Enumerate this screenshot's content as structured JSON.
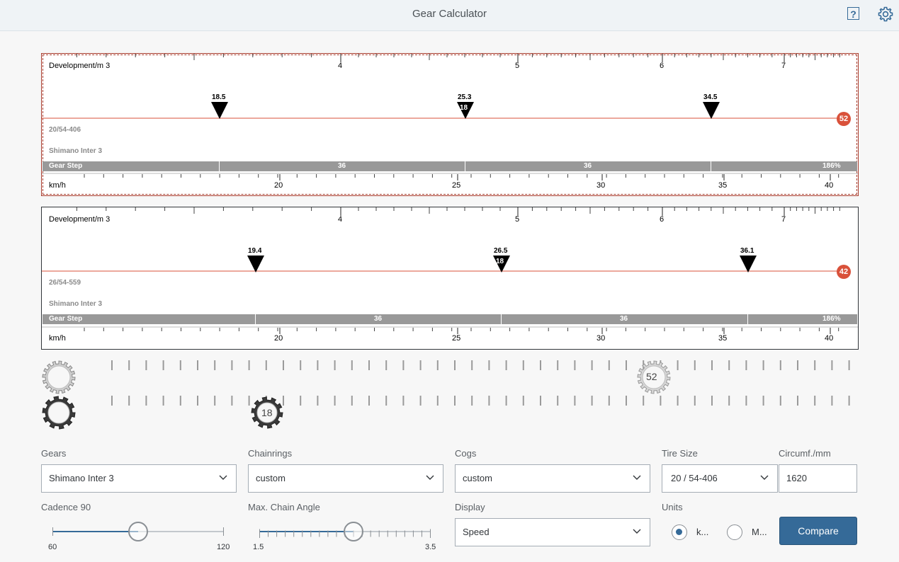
{
  "app": {
    "title": "Gear Calculator"
  },
  "header": {
    "help_label": "?",
    "help_icon": "help-icon",
    "settings_icon": "gear-icon"
  },
  "panels": [
    {
      "dev_label": "Development/m 3",
      "dev_ticks": [
        "4",
        "5",
        "6",
        "7"
      ],
      "gears": [
        {
          "value": "18.5",
          "badge": ""
        },
        {
          "value": "25.3",
          "badge": "18"
        },
        {
          "value": "34.5",
          "badge": ""
        }
      ],
      "tire": "20/54-406",
      "hub": "Shimano Inter 3",
      "step_label": "Gear Step",
      "steps": [
        "36",
        "36"
      ],
      "total": "186%",
      "speed_label": "km/h",
      "speed_ticks": [
        "20",
        "25",
        "30",
        "35",
        "40"
      ],
      "chainring": "52",
      "selected": true
    },
    {
      "dev_label": "Development/m 3",
      "dev_ticks": [
        "4",
        "5",
        "6",
        "7"
      ],
      "gears": [
        {
          "value": "19.4",
          "badge": ""
        },
        {
          "value": "26.5",
          "badge": "18"
        },
        {
          "value": "36.1",
          "badge": ""
        }
      ],
      "tire": "26/54-559",
      "hub": "Shimano Inter 3",
      "step_label": "Gear Step",
      "steps": [
        "36",
        "36"
      ],
      "total": "186%",
      "speed_label": "km/h",
      "speed_ticks": [
        "20",
        "25",
        "30",
        "35",
        "40"
      ],
      "chainring": "42",
      "selected": false
    }
  ],
  "drivetrain": {
    "chainring_label": "52",
    "cog_label": "18"
  },
  "controls": {
    "gears": {
      "label": "Gears",
      "value": "Shimano Inter 3"
    },
    "chainrings": {
      "label": "Chainrings",
      "value": "custom"
    },
    "cogs": {
      "label": "Cogs",
      "value": "custom"
    },
    "tire_size": {
      "label": "Tire Size",
      "value": "20 / 54-406"
    },
    "circumference": {
      "label": "Circumf./mm",
      "value": "1620"
    },
    "cadence": {
      "label": "Cadence 90",
      "min": "60",
      "max": "120",
      "value": 90
    },
    "chain_angle": {
      "label": "Max. Chain Angle",
      "min": "1.5",
      "max": "3.5",
      "value": 2.5
    },
    "display": {
      "label": "Display",
      "value": "Speed"
    },
    "units": {
      "label": "Units",
      "option_km": "k...",
      "option_mi": "M...",
      "selected": "km"
    },
    "compare_label": "Compare"
  },
  "colors": {
    "accent": "#356a98",
    "ring_badge": "#d9513a",
    "gear_line": "#d9513a",
    "step_bar": "#999999"
  }
}
